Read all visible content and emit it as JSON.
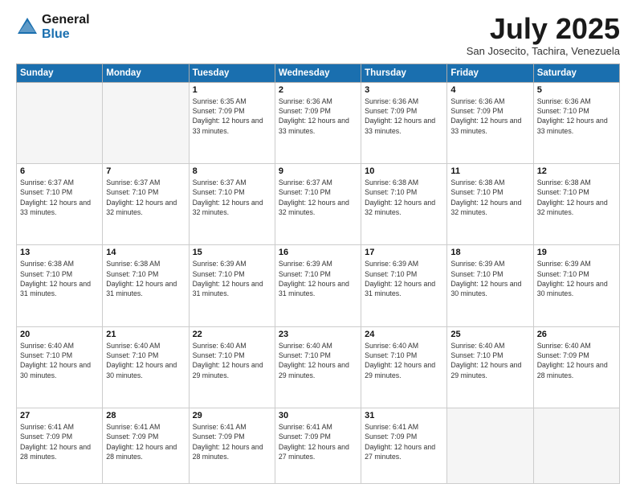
{
  "header": {
    "logo_general": "General",
    "logo_blue": "Blue",
    "month_title": "July 2025",
    "subtitle": "San Josecito, Tachira, Venezuela"
  },
  "days_of_week": [
    "Sunday",
    "Monday",
    "Tuesday",
    "Wednesday",
    "Thursday",
    "Friday",
    "Saturday"
  ],
  "weeks": [
    [
      {
        "day": "",
        "info": ""
      },
      {
        "day": "",
        "info": ""
      },
      {
        "day": "1",
        "info": "Sunrise: 6:35 AM\nSunset: 7:09 PM\nDaylight: 12 hours\nand 33 minutes."
      },
      {
        "day": "2",
        "info": "Sunrise: 6:36 AM\nSunset: 7:09 PM\nDaylight: 12 hours\nand 33 minutes."
      },
      {
        "day": "3",
        "info": "Sunrise: 6:36 AM\nSunset: 7:09 PM\nDaylight: 12 hours\nand 33 minutes."
      },
      {
        "day": "4",
        "info": "Sunrise: 6:36 AM\nSunset: 7:09 PM\nDaylight: 12 hours\nand 33 minutes."
      },
      {
        "day": "5",
        "info": "Sunrise: 6:36 AM\nSunset: 7:10 PM\nDaylight: 12 hours\nand 33 minutes."
      }
    ],
    [
      {
        "day": "6",
        "info": "Sunrise: 6:37 AM\nSunset: 7:10 PM\nDaylight: 12 hours\nand 33 minutes."
      },
      {
        "day": "7",
        "info": "Sunrise: 6:37 AM\nSunset: 7:10 PM\nDaylight: 12 hours\nand 32 minutes."
      },
      {
        "day": "8",
        "info": "Sunrise: 6:37 AM\nSunset: 7:10 PM\nDaylight: 12 hours\nand 32 minutes."
      },
      {
        "day": "9",
        "info": "Sunrise: 6:37 AM\nSunset: 7:10 PM\nDaylight: 12 hours\nand 32 minutes."
      },
      {
        "day": "10",
        "info": "Sunrise: 6:38 AM\nSunset: 7:10 PM\nDaylight: 12 hours\nand 32 minutes."
      },
      {
        "day": "11",
        "info": "Sunrise: 6:38 AM\nSunset: 7:10 PM\nDaylight: 12 hours\nand 32 minutes."
      },
      {
        "day": "12",
        "info": "Sunrise: 6:38 AM\nSunset: 7:10 PM\nDaylight: 12 hours\nand 32 minutes."
      }
    ],
    [
      {
        "day": "13",
        "info": "Sunrise: 6:38 AM\nSunset: 7:10 PM\nDaylight: 12 hours\nand 31 minutes."
      },
      {
        "day": "14",
        "info": "Sunrise: 6:38 AM\nSunset: 7:10 PM\nDaylight: 12 hours\nand 31 minutes."
      },
      {
        "day": "15",
        "info": "Sunrise: 6:39 AM\nSunset: 7:10 PM\nDaylight: 12 hours\nand 31 minutes."
      },
      {
        "day": "16",
        "info": "Sunrise: 6:39 AM\nSunset: 7:10 PM\nDaylight: 12 hours\nand 31 minutes."
      },
      {
        "day": "17",
        "info": "Sunrise: 6:39 AM\nSunset: 7:10 PM\nDaylight: 12 hours\nand 31 minutes."
      },
      {
        "day": "18",
        "info": "Sunrise: 6:39 AM\nSunset: 7:10 PM\nDaylight: 12 hours\nand 30 minutes."
      },
      {
        "day": "19",
        "info": "Sunrise: 6:39 AM\nSunset: 7:10 PM\nDaylight: 12 hours\nand 30 minutes."
      }
    ],
    [
      {
        "day": "20",
        "info": "Sunrise: 6:40 AM\nSunset: 7:10 PM\nDaylight: 12 hours\nand 30 minutes."
      },
      {
        "day": "21",
        "info": "Sunrise: 6:40 AM\nSunset: 7:10 PM\nDaylight: 12 hours\nand 30 minutes."
      },
      {
        "day": "22",
        "info": "Sunrise: 6:40 AM\nSunset: 7:10 PM\nDaylight: 12 hours\nand 29 minutes."
      },
      {
        "day": "23",
        "info": "Sunrise: 6:40 AM\nSunset: 7:10 PM\nDaylight: 12 hours\nand 29 minutes."
      },
      {
        "day": "24",
        "info": "Sunrise: 6:40 AM\nSunset: 7:10 PM\nDaylight: 12 hours\nand 29 minutes."
      },
      {
        "day": "25",
        "info": "Sunrise: 6:40 AM\nSunset: 7:10 PM\nDaylight: 12 hours\nand 29 minutes."
      },
      {
        "day": "26",
        "info": "Sunrise: 6:40 AM\nSunset: 7:09 PM\nDaylight: 12 hours\nand 28 minutes."
      }
    ],
    [
      {
        "day": "27",
        "info": "Sunrise: 6:41 AM\nSunset: 7:09 PM\nDaylight: 12 hours\nand 28 minutes."
      },
      {
        "day": "28",
        "info": "Sunrise: 6:41 AM\nSunset: 7:09 PM\nDaylight: 12 hours\nand 28 minutes."
      },
      {
        "day": "29",
        "info": "Sunrise: 6:41 AM\nSunset: 7:09 PM\nDaylight: 12 hours\nand 28 minutes."
      },
      {
        "day": "30",
        "info": "Sunrise: 6:41 AM\nSunset: 7:09 PM\nDaylight: 12 hours\nand 27 minutes."
      },
      {
        "day": "31",
        "info": "Sunrise: 6:41 AM\nSunset: 7:09 PM\nDaylight: 12 hours\nand 27 minutes."
      },
      {
        "day": "",
        "info": ""
      },
      {
        "day": "",
        "info": ""
      }
    ]
  ]
}
